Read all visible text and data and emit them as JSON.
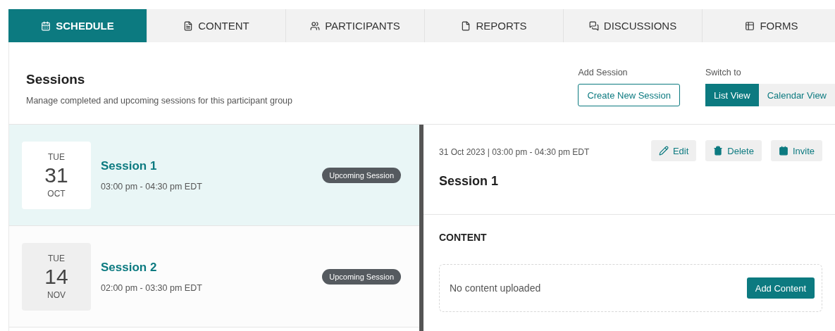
{
  "tabs": [
    {
      "label": "SCHEDULE",
      "selected": true
    },
    {
      "label": "CONTENT",
      "selected": false
    },
    {
      "label": "PARTICIPANTS",
      "selected": false
    },
    {
      "label": "REPORTS",
      "selected": false
    },
    {
      "label": "DISCUSSIONS",
      "selected": false
    },
    {
      "label": "FORMS",
      "selected": false
    }
  ],
  "header": {
    "title": "Sessions",
    "subtitle": "Manage completed and upcoming sessions for this participant group",
    "add_label": "Add Session",
    "add_button": "Create New Session",
    "switch_label": "Switch to",
    "views": [
      {
        "label": "List View",
        "selected": true
      },
      {
        "label": "Calendar View",
        "selected": false
      }
    ]
  },
  "sessions": [
    {
      "weekday": "TUE",
      "day": "31",
      "month": "OCT",
      "title": "Session 1",
      "time": "03:00 pm - 04:30 pm EDT",
      "badge": "Upcoming Session",
      "selected": true
    },
    {
      "weekday": "TUE",
      "day": "14",
      "month": "NOV",
      "title": "Session 2",
      "time": "02:00 pm - 03:30 pm EDT",
      "badge": "Upcoming Session",
      "selected": false
    }
  ],
  "detail": {
    "datetime": "31 Oct 2023 | 03:00 pm - 04:30 pm EDT",
    "actions": [
      "Edit",
      "Delete",
      "Invite"
    ],
    "title": "Session 1",
    "content_heading": "CONTENT",
    "empty_text": "No content uploaded",
    "add_button": "Add Content"
  }
}
